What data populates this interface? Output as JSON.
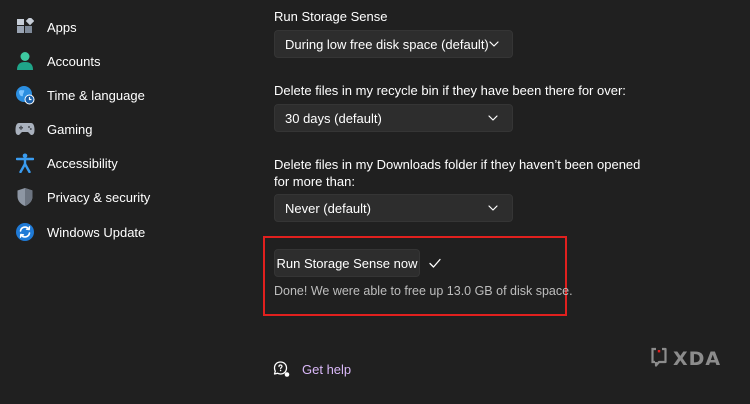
{
  "sidebar": {
    "items": [
      {
        "label": "Apps",
        "icon": "apps-icon"
      },
      {
        "label": "Accounts",
        "icon": "accounts-icon"
      },
      {
        "label": "Time & language",
        "icon": "time-language-icon"
      },
      {
        "label": "Gaming",
        "icon": "gaming-icon"
      },
      {
        "label": "Accessibility",
        "icon": "accessibility-icon"
      },
      {
        "label": "Privacy & security",
        "icon": "privacy-security-icon"
      },
      {
        "label": "Windows Update",
        "icon": "windows-update-icon"
      }
    ]
  },
  "storage_sense": {
    "run_label": "Run Storage Sense",
    "run_value": "During low free disk space (default)",
    "recycle_label": "Delete files in my recycle bin if they have been there for over:",
    "recycle_value": "30 days (default)",
    "downloads_label": "Delete files in my Downloads folder if they haven’t been opened for more than:",
    "downloads_value": "Never (default)",
    "run_now_button": "Run Storage Sense now",
    "status": "Done! We were able to free up 13.0 GB of disk space."
  },
  "help": {
    "label": "Get help"
  },
  "watermark": {
    "text": "XDA"
  },
  "colors": {
    "background": "#202020",
    "control": "#2d2d2d",
    "accent_link": "#d9b8f8",
    "highlight": "#e0201e"
  }
}
